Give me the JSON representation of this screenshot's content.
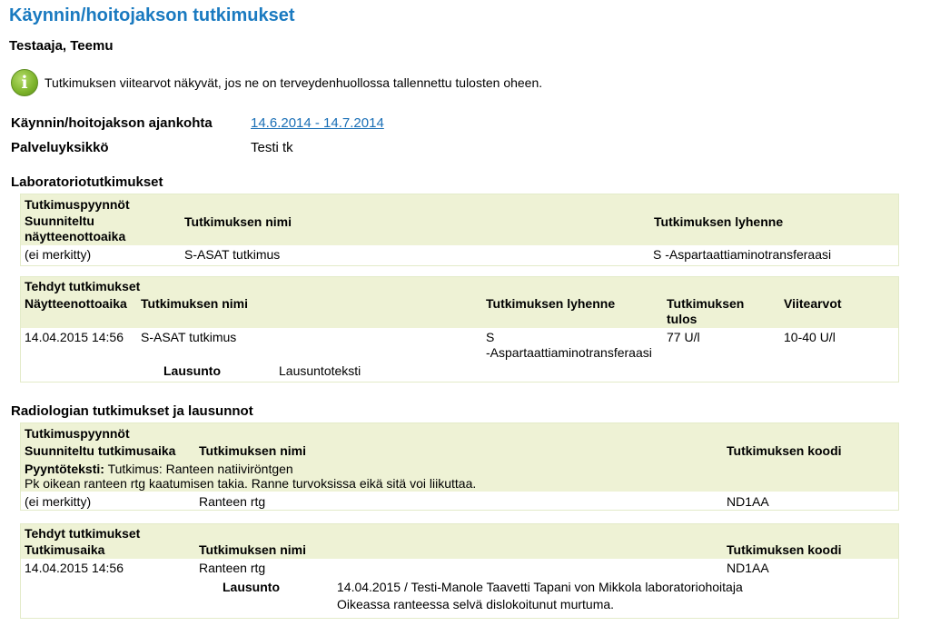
{
  "page": {
    "title": "Käynnin/hoitojakson tutkimukset",
    "patient_name": "Testaaja, Teemu",
    "info_text": "Tutkimuksen viitearvot näkyvät, jos ne on terveydenhuollossa tallennettu tulosten oheen.",
    "info_icon_glyph": "i"
  },
  "meta": {
    "period_label": "Käynnin/hoitojakson ajankohta",
    "period_value": "14.6.2014 - 14.7.2014",
    "unit_label": "Palveluyksikkö",
    "unit_value": "Testi tk"
  },
  "lab": {
    "title": "Laboratoriotutkimukset",
    "requests": {
      "heading": "Tutkimuspyynnöt",
      "col1": "Suunniteltu",
      "col1b": "näytteenottoaika",
      "col2": "Tutkimuksen nimi",
      "col3": "Tutkimuksen lyhenne",
      "row": {
        "time": "(ei merkitty)",
        "name": "S-ASAT tutkimus",
        "abbr": "S -Aspartaattiaminotransferaasi"
      }
    },
    "done": {
      "heading": "Tehdyt tutkimukset",
      "col1": "Näytteenottoaika",
      "col2": "Tutkimuksen nimi",
      "col3": "Tutkimuksen lyhenne",
      "col4": "Tutkimuksen",
      "col4b": "tulos",
      "col5": "Viitearvot",
      "row": {
        "time": "14.04.2015 14:56",
        "name": "S-ASAT tutkimus",
        "abbr1": "S",
        "abbr2": "-Aspartaattiaminotransferaasi",
        "result": "77 U/l",
        "ref": "10-40 U/l"
      },
      "statement_label": "Lausunto",
      "statement_text": "Lausuntoteksti"
    }
  },
  "radiology": {
    "title": "Radiologian tutkimukset ja lausunnot",
    "requests": {
      "heading": "Tutkimuspyynnöt",
      "col1": "Suunniteltu tutkimusaika",
      "col2": "Tutkimuksen nimi",
      "col3": "Tutkimuksen koodi",
      "request_label": "Pyyntöteksti:",
      "request_text1": "Tutkimus: Ranteen natiiviröntgen",
      "request_text2": "Pk oikean ranteen rtg kaatumisen takia. Ranne turvoksissa eikä sitä voi liikuttaa.",
      "row": {
        "time": "(ei merkitty)",
        "name": "Ranteen rtg",
        "code": "ND1AA"
      }
    },
    "done": {
      "heading": "Tehdyt tutkimukset",
      "col1": "Tutkimusaika",
      "col2": "Tutkimuksen nimi",
      "col3": "Tutkimuksen koodi",
      "row": {
        "time": "14.04.2015 14:56",
        "name": "Ranteen rtg",
        "code": "ND1AA"
      },
      "statement_label": "Lausunto",
      "statement_line1": "14.04.2015 / Testi-Manole Taavetti Tapani von Mikkola laboratoriohoitaja",
      "statement_line2": "Oikeassa ranteessa selvä dislokoitunut murtuma."
    }
  }
}
